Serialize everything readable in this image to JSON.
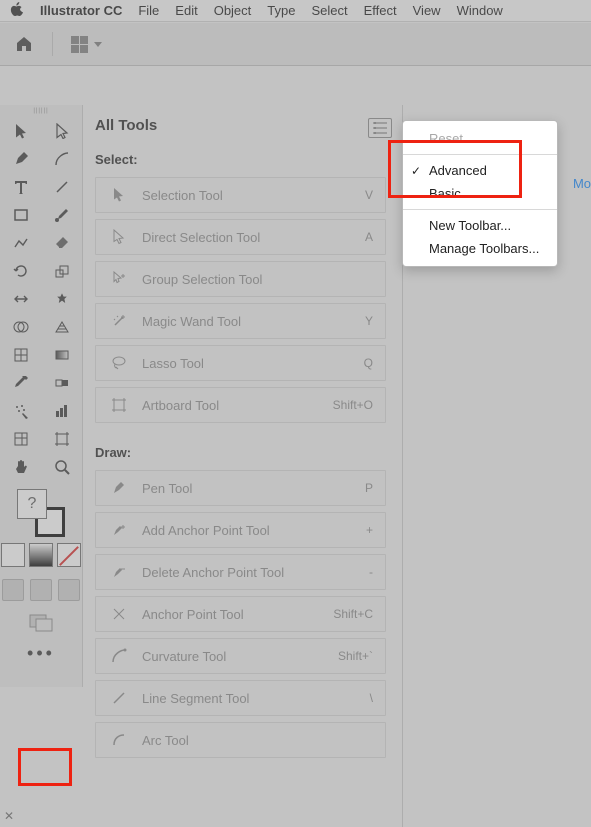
{
  "menubar": {
    "app": "Illustrator CC",
    "items": [
      "File",
      "Edit",
      "Object",
      "Type",
      "Select",
      "Effect",
      "View",
      "Window"
    ]
  },
  "all_tools": {
    "title": "All Tools",
    "sections": [
      {
        "label": "Select:",
        "tools": [
          {
            "name": "Selection Tool",
            "shortcut": "V",
            "icon": "cursor"
          },
          {
            "name": "Direct Selection Tool",
            "shortcut": "A",
            "icon": "cursor-white"
          },
          {
            "name": "Group Selection Tool",
            "shortcut": "",
            "icon": "cursor-plus"
          },
          {
            "name": "Magic Wand Tool",
            "shortcut": "Y",
            "icon": "wand"
          },
          {
            "name": "Lasso Tool",
            "shortcut": "Q",
            "icon": "lasso"
          },
          {
            "name": "Artboard Tool",
            "shortcut": "Shift+O",
            "icon": "artboard"
          }
        ]
      },
      {
        "label": "Draw:",
        "tools": [
          {
            "name": "Pen Tool",
            "shortcut": "P",
            "icon": "pen"
          },
          {
            "name": "Add Anchor Point Tool",
            "shortcut": "+",
            "icon": "pen-plus"
          },
          {
            "name": "Delete Anchor Point Tool",
            "shortcut": "-",
            "icon": "pen-minus"
          },
          {
            "name": "Anchor Point Tool",
            "shortcut": "Shift+C",
            "icon": "anchor"
          },
          {
            "name": "Curvature Tool",
            "shortcut": "Shift+`",
            "icon": "curve"
          },
          {
            "name": "Line Segment Tool",
            "shortcut": "\\",
            "icon": "line"
          },
          {
            "name": "Arc Tool",
            "shortcut": "",
            "icon": "arc"
          }
        ]
      }
    ]
  },
  "dropdown": {
    "reset": "Reset",
    "advanced": "Advanced",
    "basic": "Basic",
    "new_toolbar": "New Toolbar...",
    "manage_toolbars": "Manage Toolbars..."
  },
  "right_link": "Mo",
  "fillstroke_question": "?",
  "more_label": "•••"
}
